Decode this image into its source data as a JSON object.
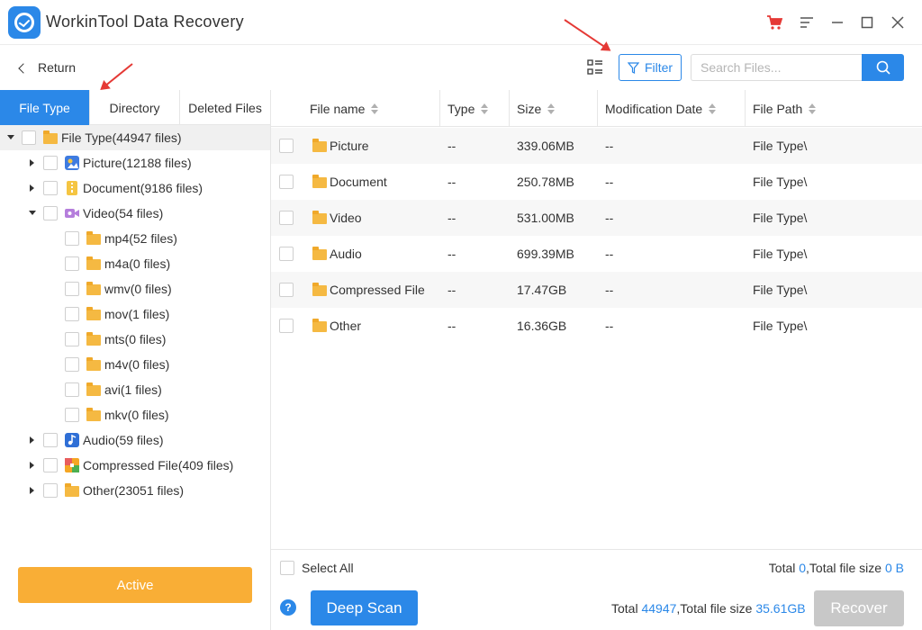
{
  "app": {
    "title": "WorkinTool Data Recovery"
  },
  "toolbar": {
    "return_label": "Return",
    "filter_label": "Filter",
    "search_placeholder": "Search Files..."
  },
  "tabs": [
    {
      "label": "File Type",
      "active": true
    },
    {
      "label": "Directory",
      "active": false
    },
    {
      "label": "Deleted Files",
      "active": false
    }
  ],
  "tree": {
    "root": "File Type(44947 files)",
    "items": [
      {
        "label": "Picture(12188 files)",
        "icon": "picture-icon"
      },
      {
        "label": "Document(9186 files)",
        "icon": "document-icon"
      },
      {
        "label": "Video(54 files)",
        "icon": "video-icon",
        "expanded": true,
        "children": [
          "mp4(52 files)",
          "m4a(0 files)",
          "wmv(0 files)",
          "mov(1 files)",
          "mts(0 files)",
          "m4v(0 files)",
          "avi(1 files)",
          "mkv(0 files)"
        ]
      },
      {
        "label": "Audio(59 files)",
        "icon": "audio-icon"
      },
      {
        "label": "Compressed File(409 files)",
        "icon": "compressed-file-icon"
      },
      {
        "label": "Other(23051 files)",
        "icon": "other-folder-icon"
      }
    ]
  },
  "left_panel": {
    "active_button": "Active"
  },
  "table": {
    "columns": [
      "File name",
      "Type",
      "Size",
      "Modification Date",
      "File Path"
    ],
    "rows": [
      {
        "name": "Picture",
        "type": "--",
        "size": "339.06MB",
        "date": "--",
        "path": "File Type\\"
      },
      {
        "name": "Document",
        "type": "--",
        "size": "250.78MB",
        "date": "--",
        "path": "File Type\\"
      },
      {
        "name": "Video",
        "type": "--",
        "size": "531.00MB",
        "date": "--",
        "path": "File Type\\"
      },
      {
        "name": "Audio",
        "type": "--",
        "size": "699.39MB",
        "date": "--",
        "path": "File Type\\"
      },
      {
        "name": "Compressed File",
        "type": "--",
        "size": "17.47GB",
        "date": "--",
        "path": "File Type\\"
      },
      {
        "name": "Other",
        "type": "--",
        "size": "16.36GB",
        "date": "--",
        "path": "File Type\\"
      }
    ]
  },
  "footer": {
    "select_all": "Select All",
    "selected_total_prefix": "Total ",
    "selected_count": "0",
    "selected_size_prefix": ",Total file size ",
    "selected_size": "0 B",
    "deep_scan": "Deep Scan",
    "all_total_prefix": "Total ",
    "all_count": "44947",
    "all_size_prefix": ",Total file size ",
    "all_size": "35.61GB",
    "recover": "Recover",
    "help": "?"
  },
  "colors": {
    "accent": "#2b88e8",
    "active_button": "#f9ae36",
    "disabled": "#c8c8c8",
    "annotation_arrow": "#e53935"
  }
}
